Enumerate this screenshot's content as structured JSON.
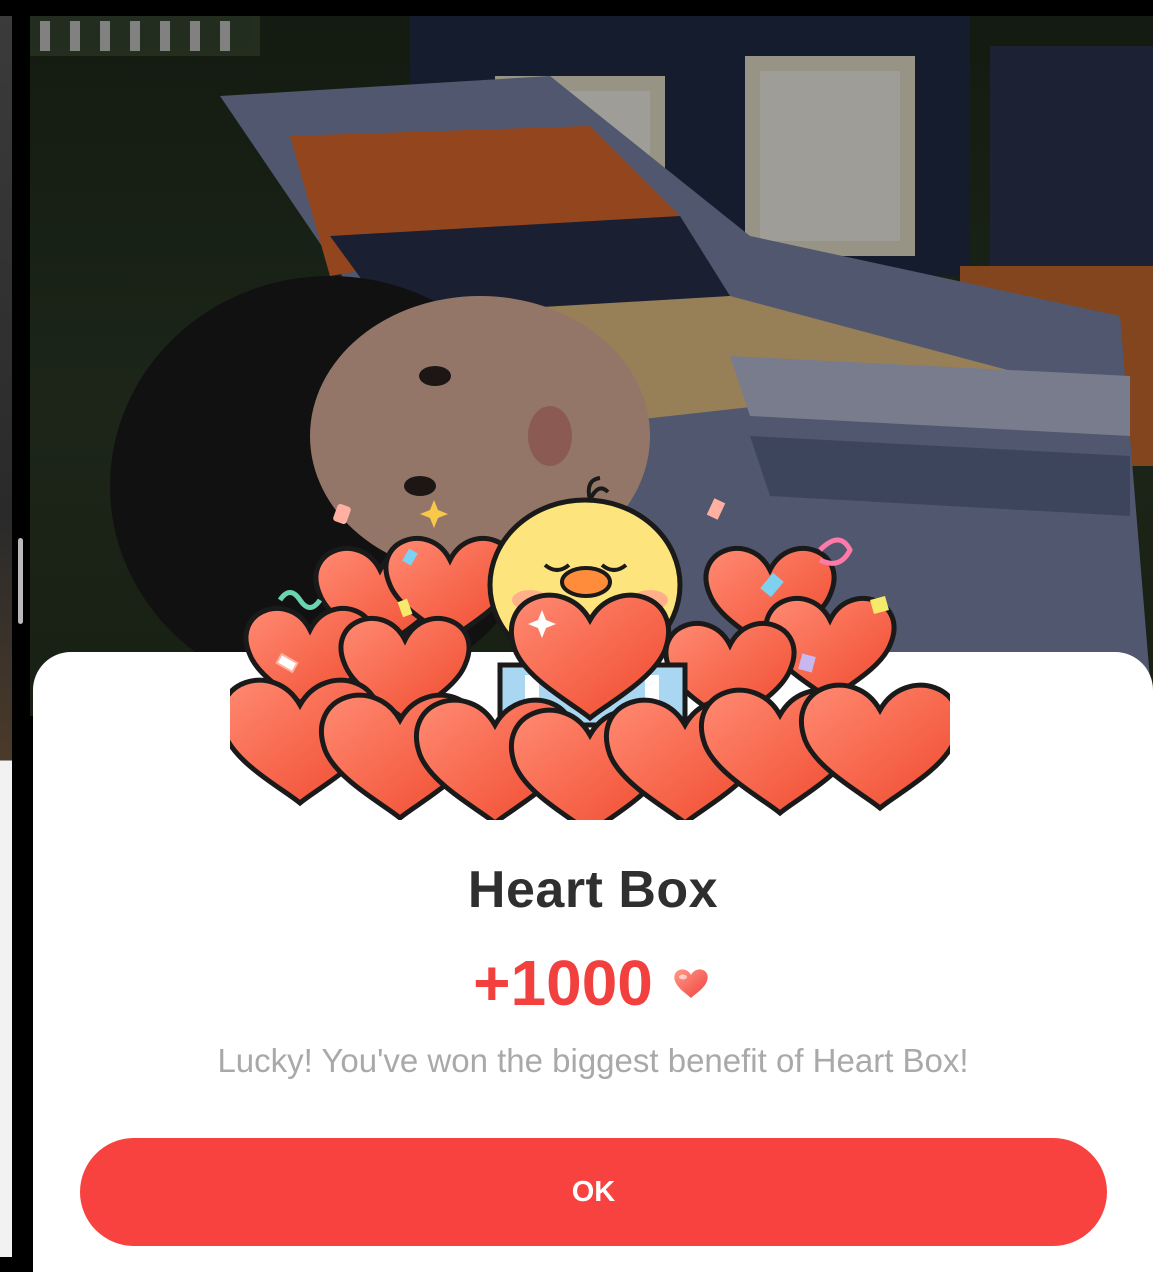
{
  "modal": {
    "title": "Heart Box",
    "reward_amount": "+1000",
    "reward_icon": "heart-icon",
    "message": "Lucky! You've won the biggest benefit of Heart Box!",
    "ok_label": "OK"
  },
  "colors": {
    "accent": "#f8423f",
    "reward_text": "#f2403f",
    "title_text": "#2f2f2f",
    "message_text": "#a9a9a9",
    "sheet_background": "#ffffff"
  },
  "illustration": {
    "character": "yellow-chick",
    "objects": [
      "hearts-pile",
      "gift-box",
      "confetti"
    ]
  }
}
